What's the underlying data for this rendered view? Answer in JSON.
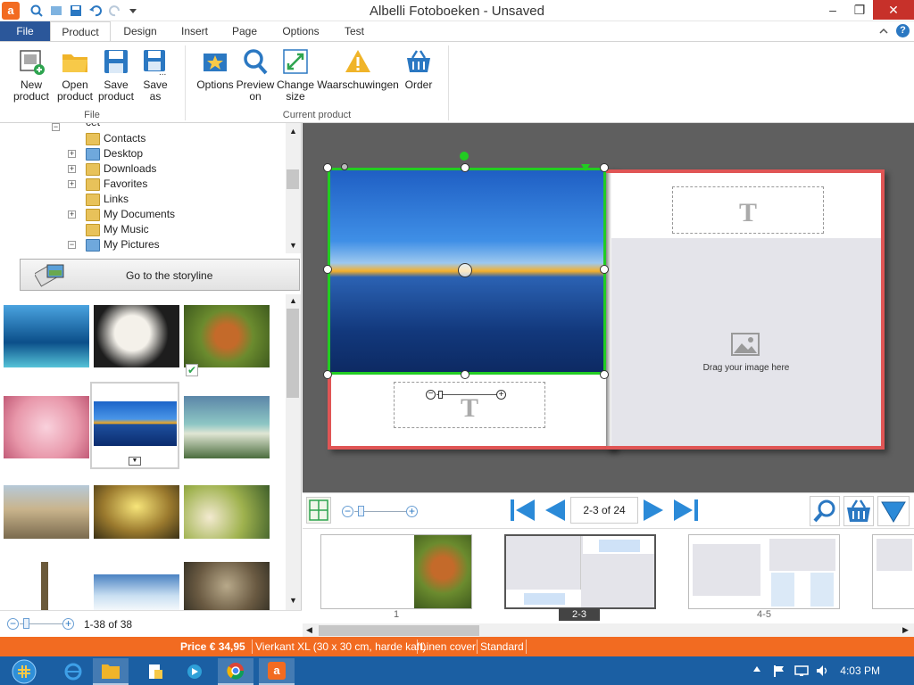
{
  "window": {
    "title": "Albelli Fotoboeken - Unsaved",
    "app_icon_letter": "a"
  },
  "ribbon_tabs": [
    "File",
    "Product",
    "Design",
    "Insert",
    "Page",
    "Options",
    "Test"
  ],
  "ribbon": {
    "file_group": {
      "label": "File",
      "buttons": [
        {
          "label": "New product",
          "icon": "new-product-icon"
        },
        {
          "label": "Open product",
          "icon": "open-folder-icon"
        },
        {
          "label": "Save product",
          "icon": "save-icon"
        },
        {
          "label": "Save as",
          "icon": "save-as-icon"
        }
      ]
    },
    "current_group": {
      "label": "Current product",
      "buttons": [
        {
          "label": "Options",
          "icon": "options-icon"
        },
        {
          "label": "Preview on",
          "icon": "preview-icon"
        },
        {
          "label": "Change size",
          "icon": "resize-icon"
        },
        {
          "label": "Waarschuwingen",
          "icon": "warning-icon"
        },
        {
          "label": "Order",
          "icon": "basket-icon"
        }
      ]
    }
  },
  "tree": {
    "partial_top": "cet",
    "items": [
      "Contacts",
      "Desktop",
      "Downloads",
      "Favorites",
      "Links",
      "My Documents",
      "My Music",
      "My Pictures"
    ]
  },
  "storyline_button": "Go to the storyline",
  "photo_count": "1-38 of 38",
  "canvas": {
    "drop_hint": "Drag your image here",
    "text_placeholder": "T"
  },
  "navigation": {
    "page_indicator": "2-3 of 24"
  },
  "spreads": [
    {
      "label": "1"
    },
    {
      "label": "2-3",
      "selected": true
    },
    {
      "label": "4-5"
    }
  ],
  "status": {
    "price": "Price € 34,95",
    "format": "Vierkant XL (30 x 30 cm, harde kaft)",
    "cover": "Linen cover",
    "paper": "Standard"
  },
  "clock": "4:03 PM",
  "colors": {
    "accent": "#f26b21",
    "ribbon_file_tab": "#2b579a",
    "page_border": "#e05555",
    "selection": "#22cc22",
    "taskbar": "#1b5fa3"
  }
}
